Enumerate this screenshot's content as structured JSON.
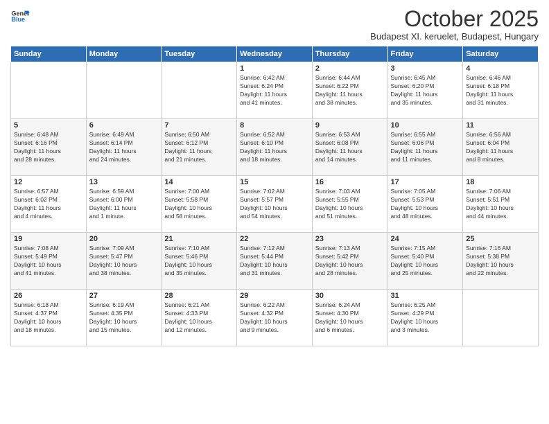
{
  "logo": {
    "line1": "General",
    "line2": "Blue"
  },
  "title": "October 2025",
  "location": "Budapest XI. keruelet, Budapest, Hungary",
  "headers": [
    "Sunday",
    "Monday",
    "Tuesday",
    "Wednesday",
    "Thursday",
    "Friday",
    "Saturday"
  ],
  "weeks": [
    [
      {
        "day": "",
        "info": ""
      },
      {
        "day": "",
        "info": ""
      },
      {
        "day": "",
        "info": ""
      },
      {
        "day": "1",
        "info": "Sunrise: 6:42 AM\nSunset: 6:24 PM\nDaylight: 11 hours\nand 41 minutes."
      },
      {
        "day": "2",
        "info": "Sunrise: 6:44 AM\nSunset: 6:22 PM\nDaylight: 11 hours\nand 38 minutes."
      },
      {
        "day": "3",
        "info": "Sunrise: 6:45 AM\nSunset: 6:20 PM\nDaylight: 11 hours\nand 35 minutes."
      },
      {
        "day": "4",
        "info": "Sunrise: 6:46 AM\nSunset: 6:18 PM\nDaylight: 11 hours\nand 31 minutes."
      }
    ],
    [
      {
        "day": "5",
        "info": "Sunrise: 6:48 AM\nSunset: 6:16 PM\nDaylight: 11 hours\nand 28 minutes."
      },
      {
        "day": "6",
        "info": "Sunrise: 6:49 AM\nSunset: 6:14 PM\nDaylight: 11 hours\nand 24 minutes."
      },
      {
        "day": "7",
        "info": "Sunrise: 6:50 AM\nSunset: 6:12 PM\nDaylight: 11 hours\nand 21 minutes."
      },
      {
        "day": "8",
        "info": "Sunrise: 6:52 AM\nSunset: 6:10 PM\nDaylight: 11 hours\nand 18 minutes."
      },
      {
        "day": "9",
        "info": "Sunrise: 6:53 AM\nSunset: 6:08 PM\nDaylight: 11 hours\nand 14 minutes."
      },
      {
        "day": "10",
        "info": "Sunrise: 6:55 AM\nSunset: 6:06 PM\nDaylight: 11 hours\nand 11 minutes."
      },
      {
        "day": "11",
        "info": "Sunrise: 6:56 AM\nSunset: 6:04 PM\nDaylight: 11 hours\nand 8 minutes."
      }
    ],
    [
      {
        "day": "12",
        "info": "Sunrise: 6:57 AM\nSunset: 6:02 PM\nDaylight: 11 hours\nand 4 minutes."
      },
      {
        "day": "13",
        "info": "Sunrise: 6:59 AM\nSunset: 6:00 PM\nDaylight: 11 hours\nand 1 minute."
      },
      {
        "day": "14",
        "info": "Sunrise: 7:00 AM\nSunset: 5:58 PM\nDaylight: 10 hours\nand 58 minutes."
      },
      {
        "day": "15",
        "info": "Sunrise: 7:02 AM\nSunset: 5:57 PM\nDaylight: 10 hours\nand 54 minutes."
      },
      {
        "day": "16",
        "info": "Sunrise: 7:03 AM\nSunset: 5:55 PM\nDaylight: 10 hours\nand 51 minutes."
      },
      {
        "day": "17",
        "info": "Sunrise: 7:05 AM\nSunset: 5:53 PM\nDaylight: 10 hours\nand 48 minutes."
      },
      {
        "day": "18",
        "info": "Sunrise: 7:06 AM\nSunset: 5:51 PM\nDaylight: 10 hours\nand 44 minutes."
      }
    ],
    [
      {
        "day": "19",
        "info": "Sunrise: 7:08 AM\nSunset: 5:49 PM\nDaylight: 10 hours\nand 41 minutes."
      },
      {
        "day": "20",
        "info": "Sunrise: 7:09 AM\nSunset: 5:47 PM\nDaylight: 10 hours\nand 38 minutes."
      },
      {
        "day": "21",
        "info": "Sunrise: 7:10 AM\nSunset: 5:46 PM\nDaylight: 10 hours\nand 35 minutes."
      },
      {
        "day": "22",
        "info": "Sunrise: 7:12 AM\nSunset: 5:44 PM\nDaylight: 10 hours\nand 31 minutes."
      },
      {
        "day": "23",
        "info": "Sunrise: 7:13 AM\nSunset: 5:42 PM\nDaylight: 10 hours\nand 28 minutes."
      },
      {
        "day": "24",
        "info": "Sunrise: 7:15 AM\nSunset: 5:40 PM\nDaylight: 10 hours\nand 25 minutes."
      },
      {
        "day": "25",
        "info": "Sunrise: 7:16 AM\nSunset: 5:38 PM\nDaylight: 10 hours\nand 22 minutes."
      }
    ],
    [
      {
        "day": "26",
        "info": "Sunrise: 6:18 AM\nSunset: 4:37 PM\nDaylight: 10 hours\nand 18 minutes."
      },
      {
        "day": "27",
        "info": "Sunrise: 6:19 AM\nSunset: 4:35 PM\nDaylight: 10 hours\nand 15 minutes."
      },
      {
        "day": "28",
        "info": "Sunrise: 6:21 AM\nSunset: 4:33 PM\nDaylight: 10 hours\nand 12 minutes."
      },
      {
        "day": "29",
        "info": "Sunrise: 6:22 AM\nSunset: 4:32 PM\nDaylight: 10 hours\nand 9 minutes."
      },
      {
        "day": "30",
        "info": "Sunrise: 6:24 AM\nSunset: 4:30 PM\nDaylight: 10 hours\nand 6 minutes."
      },
      {
        "day": "31",
        "info": "Sunrise: 6:25 AM\nSunset: 4:29 PM\nDaylight: 10 hours\nand 3 minutes."
      },
      {
        "day": "",
        "info": ""
      }
    ]
  ]
}
